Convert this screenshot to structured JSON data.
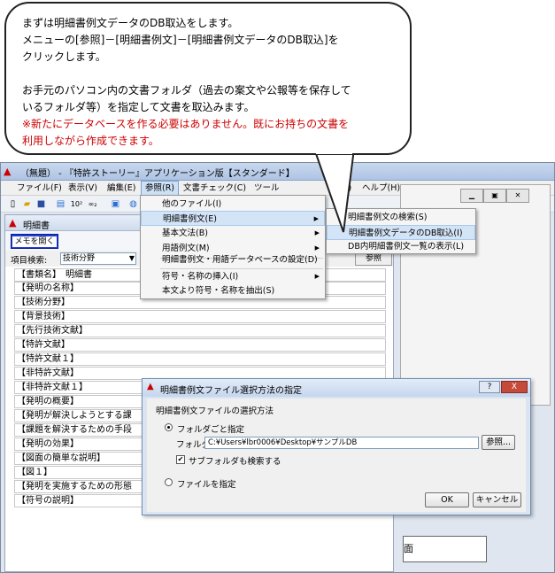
{
  "callout": {
    "lines": [
      "まずは明細書例文データのDB取込をします。",
      "メニューの[参照]－[明細書例文]－[明細書例文データのDB取込]を",
      "クリックします。",
      "",
      "お手元のパソコン内の文書フォルダ（過去の案文や公報等を保存して",
      "いるフォルダ等）を指定して文書を取込みます。",
      "※新たにデータベースを作る必要はありません。既にお持ちの文書を",
      "利用しながら作成できます。"
    ]
  },
  "window": {
    "title": "（無題） - 『特許ストーリー』アプリケーション版【スタンダード】",
    "menus": [
      "ファイル(F)",
      "表示(V)",
      "編集(E)",
      "参照(R)",
      "文書チェック(C)",
      "ツール",
      "V)",
      "ヘルプ(H)"
    ]
  },
  "doc": {
    "title": "明細書",
    "memo_label": "メモを開く",
    "search_label": "項目検索:",
    "search_value": "技術分野",
    "ref_label": "参照",
    "lines": [
      "【書類名】　明細書",
      "【発明の名称】",
      "【技術分野】",
      "【背景技術】",
      "【先行技術文献】",
      "【特許文献】",
      "【特許文献１】",
      "【非特許文献】",
      "【非特許文献１】",
      "【発明の概要】",
      "【発明が解決しようとする課",
      "【課題を解決するための手段",
      "【発明の効果】",
      "【図面の簡単な説明】",
      "【図１】",
      "【発明を実施するための形態",
      "【符号の説明】"
    ]
  },
  "sansho_menu": {
    "items": [
      {
        "label": "他のファイル(I)",
        "arrow": false
      },
      {
        "label": "明細書例文(E)",
        "arrow": true
      },
      {
        "label": "基本文法(B)",
        "arrow": true
      },
      {
        "label": "用語例文(M)",
        "arrow": true
      },
      {
        "label": "明細書例文・用語データベースの設定(D)",
        "arrow": false
      },
      {
        "label": "符号・名称の挿入(I)",
        "arrow": true
      },
      {
        "label": "本文より符号・名称を抽出(S)",
        "arrow": false
      }
    ]
  },
  "sub_menu": {
    "items": [
      "明細書例文の検索(S)",
      "明細書例文データのDB取込(I)",
      "DB内明細書例文一覧の表示(L)"
    ]
  },
  "dialog": {
    "title": "明細書例文ファイル選択方法の指定",
    "group_label": "明細書例文ファイルの選択方法",
    "opt_folder": "フォルダごと指定",
    "folder_label": "フォルダ：",
    "folder_value": "C:¥Users¥lbr0006¥Desktop¥サンプルDB",
    "browse_label": "参照...",
    "subfolder_label": "サブフォルダも検索する",
    "opt_file": "ファイルを指定",
    "ok_label": "OK",
    "cancel_label": "キャンセル",
    "help_label": "?",
    "close_label": "X"
  },
  "bg_window": {
    "text": "面"
  },
  "colors": {
    "accent": "#1d3fdc",
    "note_red": "#cc0000"
  }
}
